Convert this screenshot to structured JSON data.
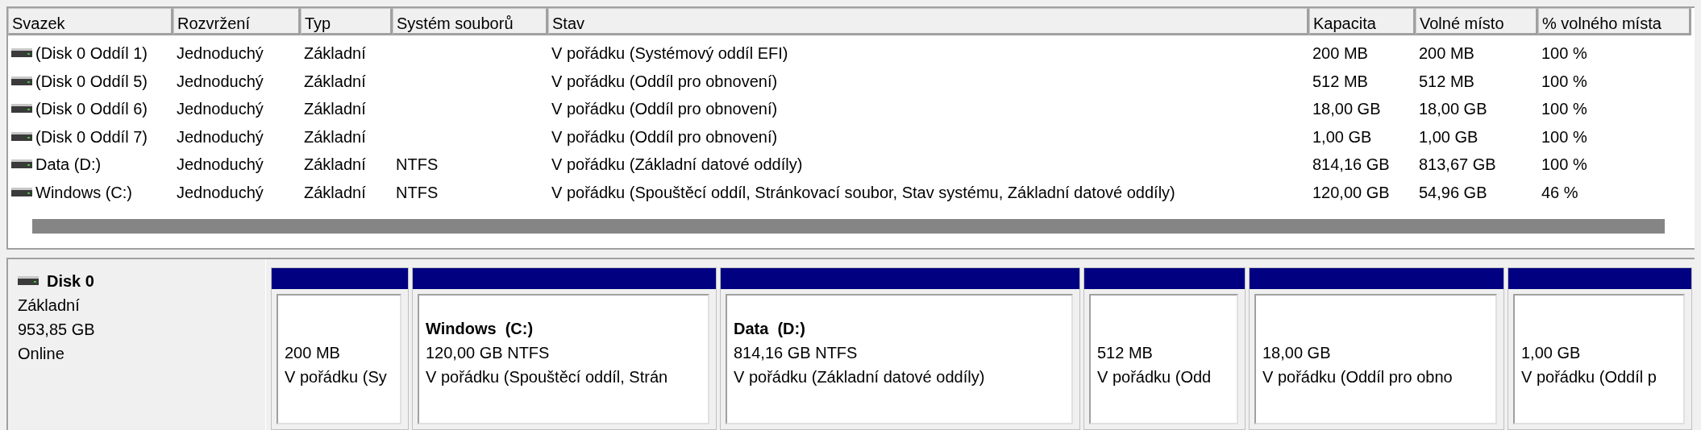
{
  "volume_table": {
    "columns": [
      "Svazek",
      "Rozvržení",
      "Typ",
      "Systém souborů",
      "Stav",
      "Kapacita",
      "Volné místo",
      "% volného místa"
    ],
    "rows": [
      {
        "cells": [
          "(Disk 0 Oddíl 1)",
          "Jednoduchý",
          "Základní",
          "",
          "V pořádku (Systémový oddíl EFI)",
          "200 MB",
          "200 MB",
          "100 %"
        ]
      },
      {
        "cells": [
          "(Disk 0 Oddíl 5)",
          "Jednoduchý",
          "Základní",
          "",
          "V pořádku (Oddíl pro obnovení)",
          "512 MB",
          "512 MB",
          "100 %"
        ]
      },
      {
        "cells": [
          "(Disk 0 Oddíl 6)",
          "Jednoduchý",
          "Základní",
          "",
          "V pořádku (Oddíl pro obnovení)",
          "18,00 GB",
          "18,00 GB",
          "100 %"
        ]
      },
      {
        "cells": [
          "(Disk 0 Oddíl 7)",
          "Jednoduchý",
          "Základní",
          "",
          "V pořádku (Oddíl pro obnovení)",
          "1,00 GB",
          "1,00 GB",
          "100 %"
        ]
      },
      {
        "cells": [
          "Data (D:)",
          "Jednoduchý",
          "Základní",
          "NTFS",
          "V pořádku (Základní datové oddíly)",
          "814,16 GB",
          "813,67 GB",
          "100 %"
        ]
      },
      {
        "cells": [
          "Windows (C:)",
          "Jednoduchý",
          "Základní",
          "NTFS",
          "V pořádku (Spouštěcí oddíl, Stránkovací soubor, Stav systému, Základní datové oddíly)",
          "120,00 GB",
          "54,96 GB",
          "46 %"
        ]
      }
    ]
  },
  "disk": {
    "name": "Disk 0",
    "type": "Základní",
    "capacity": "953,85 GB",
    "state": "Online",
    "partitions": [
      {
        "size": "200 MB",
        "status": "V pořádku (Sy"
      },
      {
        "title": "Windows  (C:)",
        "size": "120,00 GB NTFS",
        "status": "V pořádku (Spouštěcí oddíl, Strán"
      },
      {
        "title": "Data  (D:)",
        "size": "814,16 GB NTFS",
        "status": "V pořádku (Základní datové oddíly)"
      },
      {
        "size": "512 MB",
        "status": "V pořádku (Odd"
      },
      {
        "size": "18,00 GB",
        "status": "V pořádku (Oddíl pro obno"
      },
      {
        "size": "1,00 GB",
        "status": "V pořádku (Oddíl p"
      }
    ]
  }
}
